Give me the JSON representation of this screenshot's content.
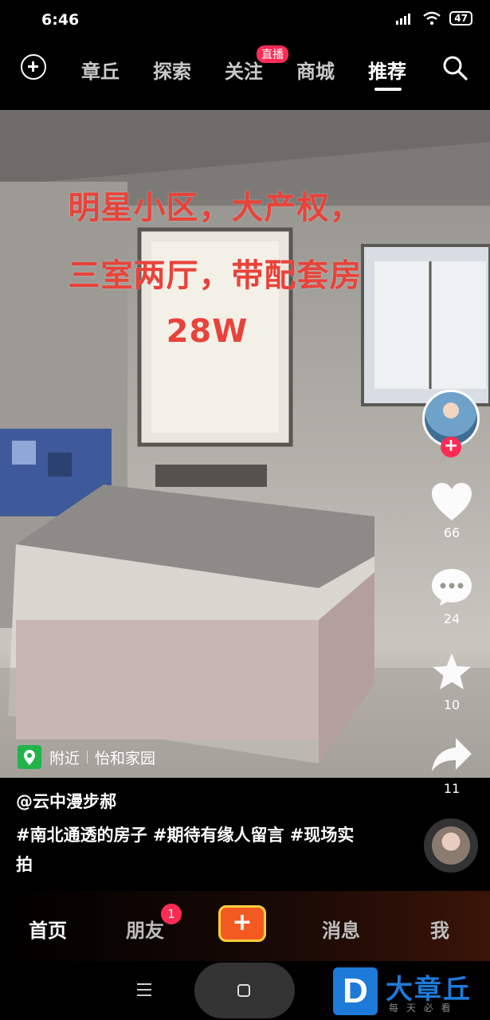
{
  "status": {
    "time": "6:46",
    "battery": "47"
  },
  "topnav": {
    "tabs": [
      "章丘",
      "探索",
      "关注",
      "商城",
      "推荐"
    ],
    "active": "推荐",
    "live_badge": "直播"
  },
  "video": {
    "caption": [
      "明星小区，大产权，",
      "三室两厅，带配套房",
      "28W"
    ]
  },
  "rail": {
    "likes": "66",
    "comments": "24",
    "favorites": "10",
    "shares": "11"
  },
  "location": {
    "tag": "附近",
    "place": "怡和家园"
  },
  "post": {
    "author": "@云中漫步郝",
    "description": "#南北通透的房子 #期待有缘人留言 #现场实拍"
  },
  "bottomnav": {
    "tabs": [
      "首页",
      "朋友",
      "消息",
      "我"
    ],
    "active": "首页",
    "friends_badge": "1",
    "create_label": "+"
  },
  "watermark": {
    "title": "大章丘",
    "subtitle": "每 天 必 看"
  },
  "colors": {
    "accent": "#fe2c55",
    "caption": "#e8433a",
    "create": "#f25a22"
  }
}
